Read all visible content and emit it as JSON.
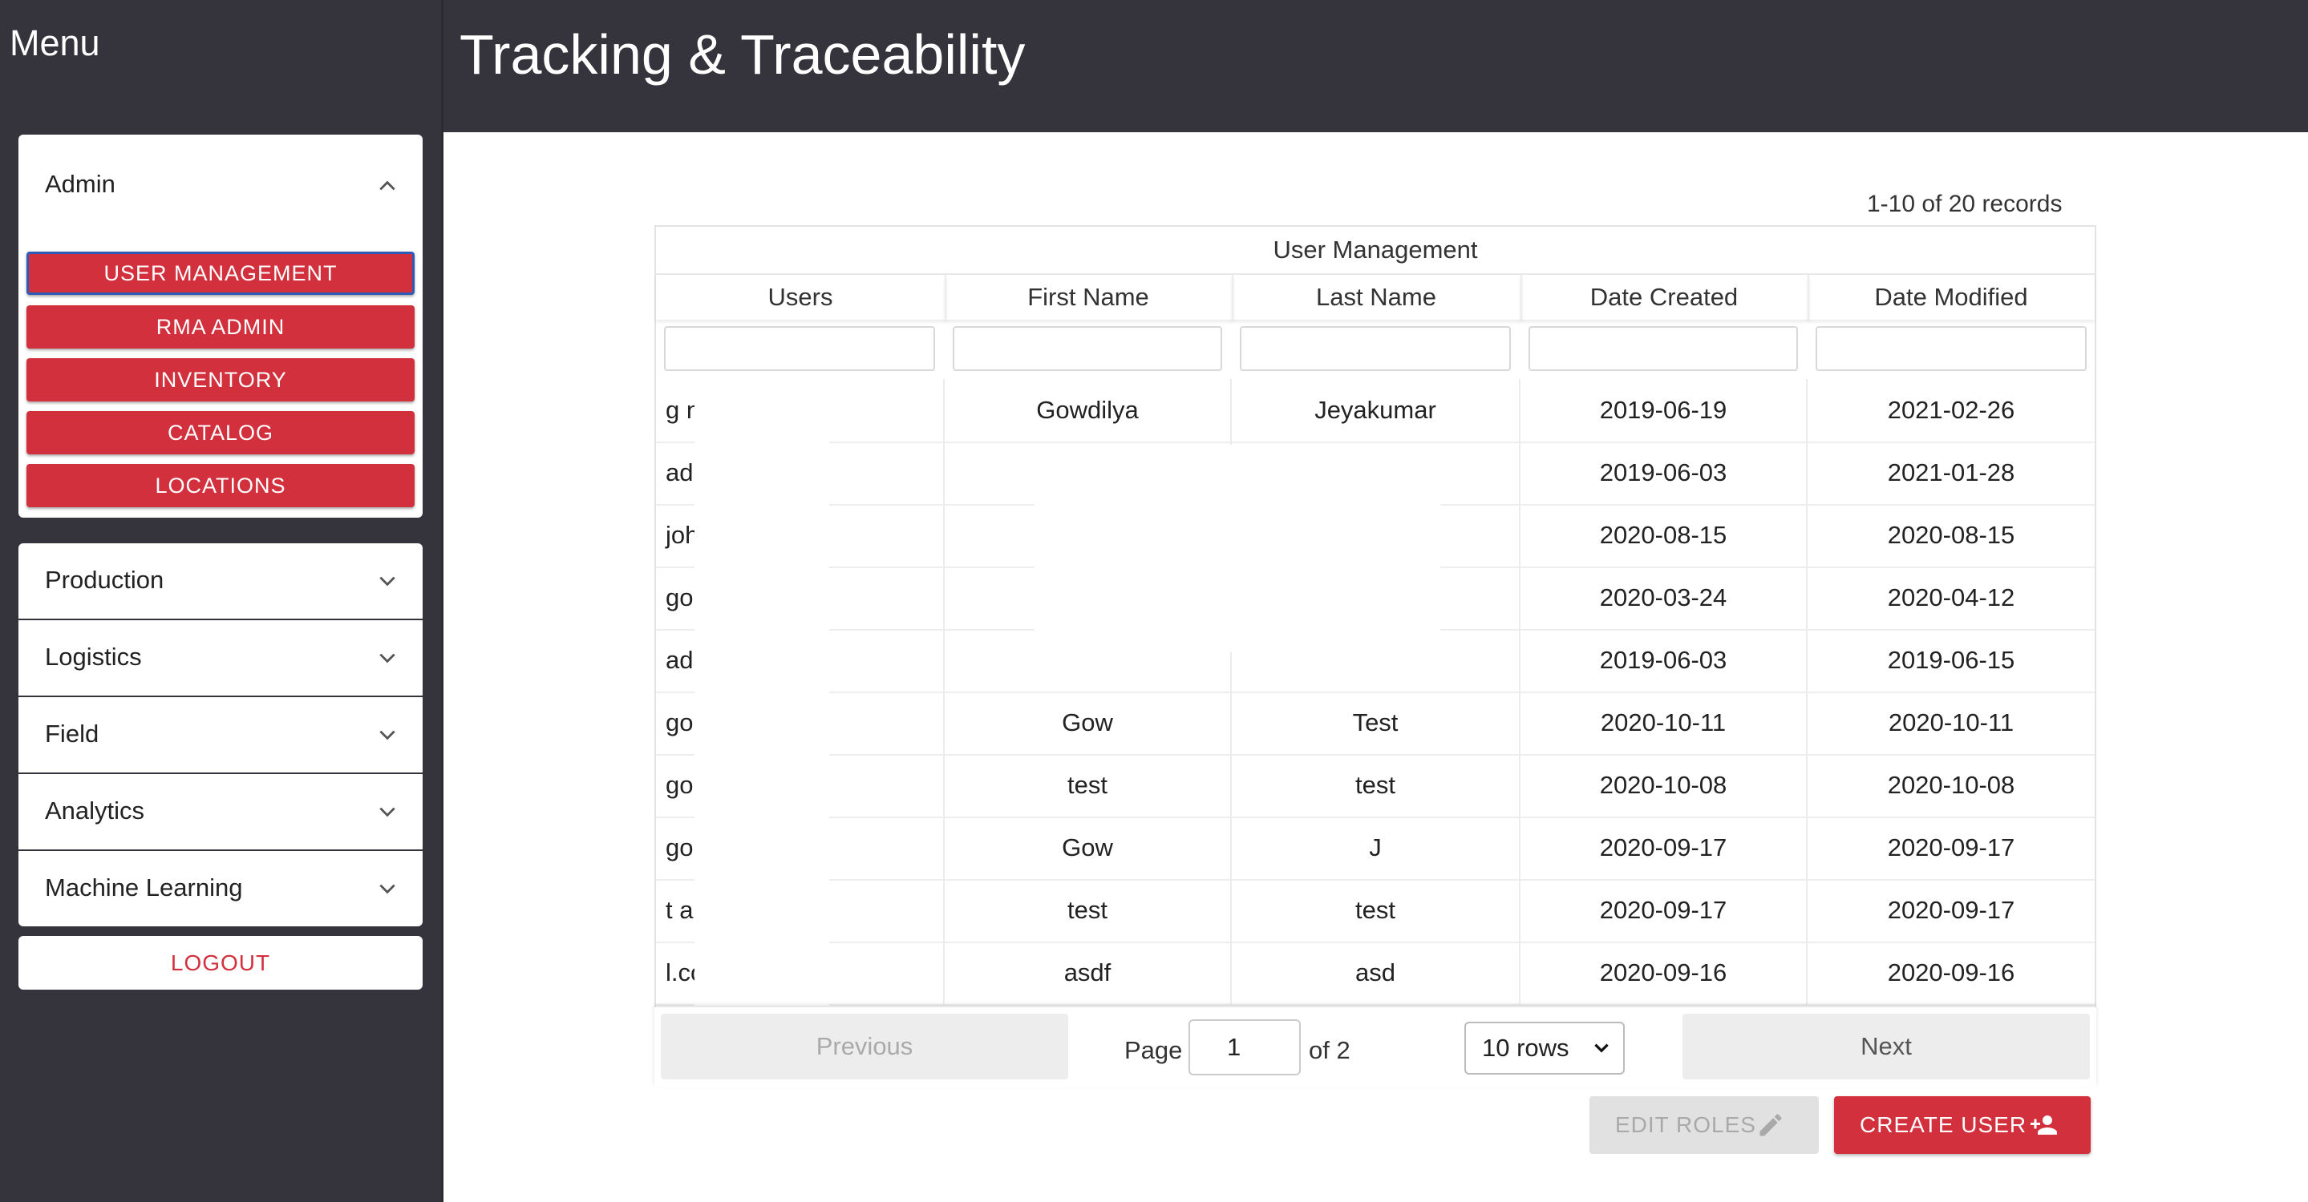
{
  "sidebar": {
    "menu_title": "Menu",
    "admin": {
      "label": "Admin",
      "buttons": [
        "USER MANAGEMENT",
        "RMA ADMIN",
        "INVENTORY",
        "CATALOG",
        "LOCATIONS"
      ]
    },
    "sections": [
      "Production",
      "Logistics",
      "Field",
      "Analytics",
      "Machine Learning"
    ],
    "logout": "LOGOUT"
  },
  "header": {
    "title": "Tracking & Traceability"
  },
  "main": {
    "records": "1-10 of 20 records",
    "table": {
      "caption": "User Management",
      "columns": [
        "Users",
        "First Name",
        "Last Name",
        "Date Created",
        "Date Modified"
      ],
      "rows": [
        {
          "user": "g           nail.com",
          "first": "Gowdilya",
          "last": "Jeyakumar",
          "created": "2019-06-19",
          "modified": "2021-02-26"
        },
        {
          "user": "ada         gmail.c…",
          "first": "",
          "last": "",
          "created": "2019-06-03",
          "modified": "2021-01-28"
        },
        {
          "user": "joh         @gmail…",
          "first": "",
          "last": "",
          "created": "2020-08-15",
          "modified": "2020-08-15"
        },
        {
          "user": "go          mail.com",
          "first": "",
          "last": "",
          "created": "2020-03-24",
          "modified": "2020-04-12"
        },
        {
          "user": "ada         gmail.c…",
          "first": "",
          "last": "",
          "created": "2019-06-03",
          "modified": "2019-06-15"
        },
        {
          "user": "go          ook.com",
          "first": "Gow",
          "last": "Test",
          "created": "2020-10-11",
          "modified": "2020-10-11"
        },
        {
          "user": "go          mail.com",
          "first": "test",
          "last": "test",
          "created": "2020-10-08",
          "modified": "2020-10-08"
        },
        {
          "user": "go          gmail.com",
          "first": "Gow",
          "last": "J",
          "created": "2020-09-17",
          "modified": "2020-09-17"
        },
        {
          "user": "t           ail.com",
          "first": "test",
          "last": "test",
          "created": "2020-09-17",
          "modified": "2020-09-17"
        },
        {
          "user": "            l.com",
          "first": "asdf",
          "last": "asd",
          "created": "2020-09-16",
          "modified": "2020-09-16"
        }
      ]
    },
    "pagination": {
      "previous": "Previous",
      "page_label": "Page",
      "page_value": "1",
      "of_label": "of 2",
      "rows_select": "10 rows",
      "next": "Next"
    },
    "actions": {
      "edit_roles": "EDIT ROLES",
      "create_user": "CREATE USER"
    }
  },
  "colors": {
    "sidebar_bg": "#35343c",
    "accent_red": "#d2303c",
    "active_border": "#2f5bb8"
  },
  "icons": [
    "chevron-up-icon",
    "chevron-down-icon",
    "pencil-icon",
    "add-person-icon"
  ]
}
